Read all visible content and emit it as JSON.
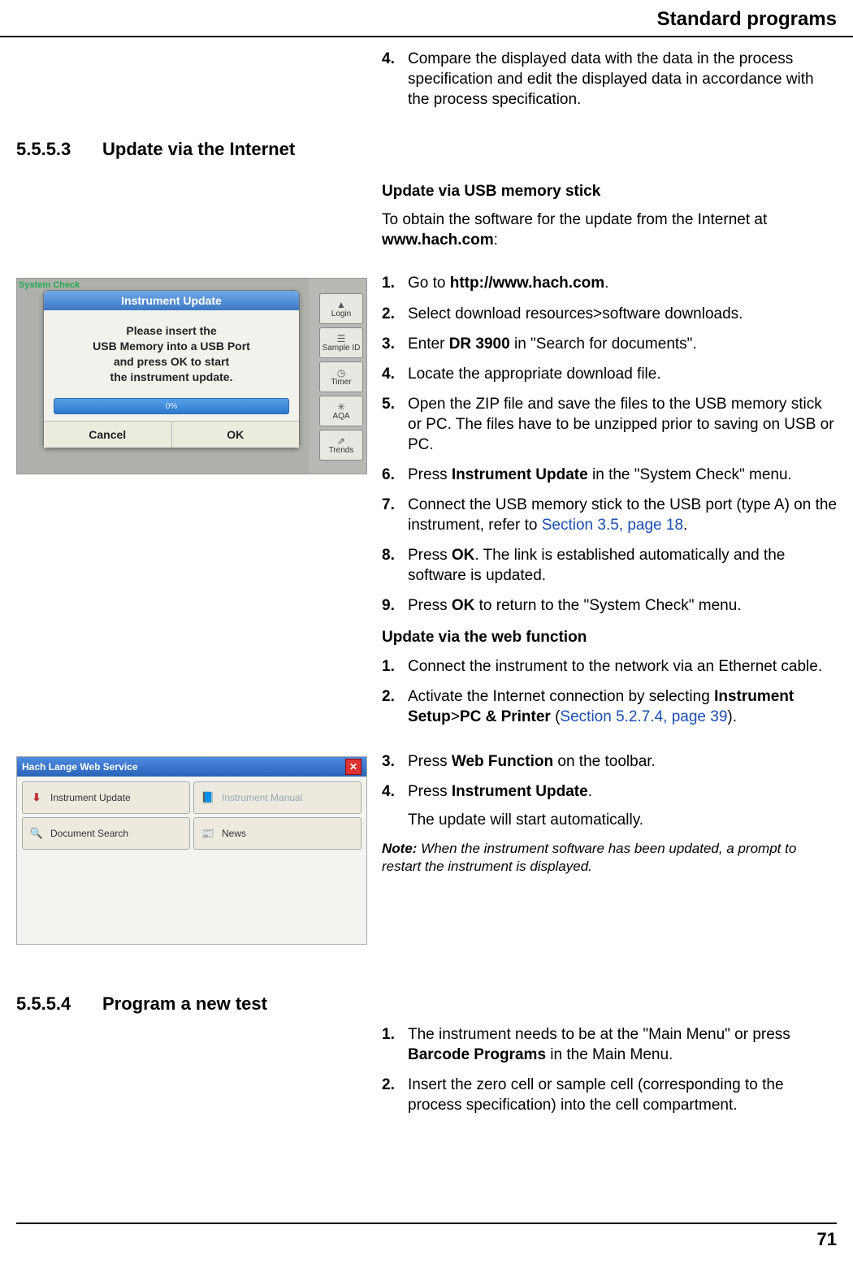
{
  "header": {
    "title": "Standard programs"
  },
  "intro_step": {
    "num": "4.",
    "text": "Compare the displayed data with the data in the process specification and edit the displayed data in accordance with the process specification."
  },
  "sec5553": {
    "num": "5.5.5.3",
    "title": "Update via the Internet",
    "usb_head": "Update via USB memory stick",
    "usb_intro_a": "To obtain the software for the update from the Internet at ",
    "usb_intro_b": "www.hach.com",
    "usb_intro_c": ":",
    "fig1": {
      "dialog_title": "Instrument Update",
      "body_l1": "Please insert the",
      "body_l2": "USB Memory into a USB Port",
      "body_l3": "and press OK to start",
      "body_l4": "the instrument update.",
      "bar": "0%",
      "btn_cancel": "Cancel",
      "btn_ok": "OK",
      "side": [
        "Login",
        "Sample ID",
        "Timer",
        "AQA",
        "Trends"
      ],
      "corner": "System Check"
    },
    "usb_steps": [
      {
        "n": "1.",
        "pre": "Go to ",
        "b": "http://www.hach.com",
        "post": "."
      },
      {
        "n": "2.",
        "t": "Select download resources>software downloads."
      },
      {
        "n": "3.",
        "pre": "Enter ",
        "b": "DR 3900",
        "post": " in \"Search for documents\"."
      },
      {
        "n": "4.",
        "t": "Locate the appropriate download file."
      },
      {
        "n": "5.",
        "t": "Open the ZIP file and save the files to the USB memory stick or PC. The files have to be unzipped prior to saving on USB or PC."
      },
      {
        "n": "6.",
        "pre": "Press ",
        "b": "Instrument Update",
        "post": " in the \"System Check\" menu."
      },
      {
        "n": "7.",
        "pre": "Connect the USB memory stick to the USB port (type  A) on the instrument, refer to ",
        "link": "Section 3.5, page 18",
        "post": "."
      },
      {
        "n": "8.",
        "pre": "Press ",
        "b": "OK",
        "post": ". The link is established automatically and the software is updated."
      },
      {
        "n": "9.",
        "pre": "Press ",
        "b": "OK",
        "post": " to return to the \"System Check\" menu."
      }
    ],
    "web_head": "Update via the web function",
    "web_steps_a": [
      {
        "n": "1.",
        "t": "Connect the instrument to the network via an Ethernet cable."
      },
      {
        "n": "2.",
        "pre": "Activate the Internet connection by selecting ",
        "b1": "Instrument Setup",
        "mid": ">",
        "b2": "PC & Printer",
        "post_a": " (",
        "link": "Section 5.2.7.4, page 39",
        "post_b": ")."
      }
    ],
    "fig2": {
      "title": "Hach Lange Web Service",
      "tiles": [
        {
          "label": "Instrument Update",
          "icon": "pdf"
        },
        {
          "label": "Instrument Manual",
          "icon": "manual",
          "dim": true
        },
        {
          "label": "Document Search",
          "icon": ""
        },
        {
          "label": "News",
          "icon": "news"
        }
      ]
    },
    "web_steps_b": [
      {
        "n": "3.",
        "pre": "Press ",
        "b": "Web Function",
        "post": " on the toolbar."
      },
      {
        "n": "4.",
        "pre": "Press ",
        "b": "Instrument Update",
        "post": ".",
        "tail": "The update will start automatically."
      }
    ],
    "note_label": "Note:",
    "note_text": " When the instrument software has been updated, a prompt to restart the instrument is displayed."
  },
  "sec5554": {
    "num": "5.5.5.4",
    "title": "Program a new test",
    "steps": [
      {
        "n": "1.",
        "pre": "The instrument needs to be at the \"Main Menu\" or press ",
        "b": "Barcode Programs",
        "post": " in the Main Menu."
      },
      {
        "n": "2.",
        "t": "Insert the zero cell or sample cell (corresponding to the process specification) into the cell compartment."
      }
    ]
  },
  "page_number": "71"
}
